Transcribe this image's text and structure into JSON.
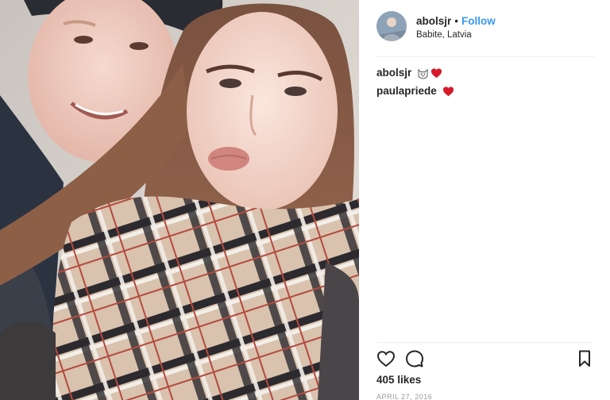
{
  "post": {
    "photo_alt": "selfie photo",
    "username": "abolsjr",
    "separator": "•",
    "follow_label": "Follow",
    "location": "Babite, Latvia"
  },
  "comments": [
    {
      "user": "abolsjr",
      "emojis": [
        "cat-face-emoji",
        "red-heart-emoji"
      ]
    },
    {
      "user": "paulapriede",
      "emojis": [
        "red-heart-emoji"
      ]
    }
  ],
  "actions": {
    "like_icon": "heart-outline-icon",
    "comment_icon": "comment-bubble-icon",
    "save_icon": "bookmark-icon"
  },
  "likes_text": "405 likes",
  "date_text": "APRIL 27, 2016",
  "colors": {
    "follow": "#3897f0",
    "text": "#262626",
    "muted": "#999999",
    "heart": "#ed4956"
  }
}
